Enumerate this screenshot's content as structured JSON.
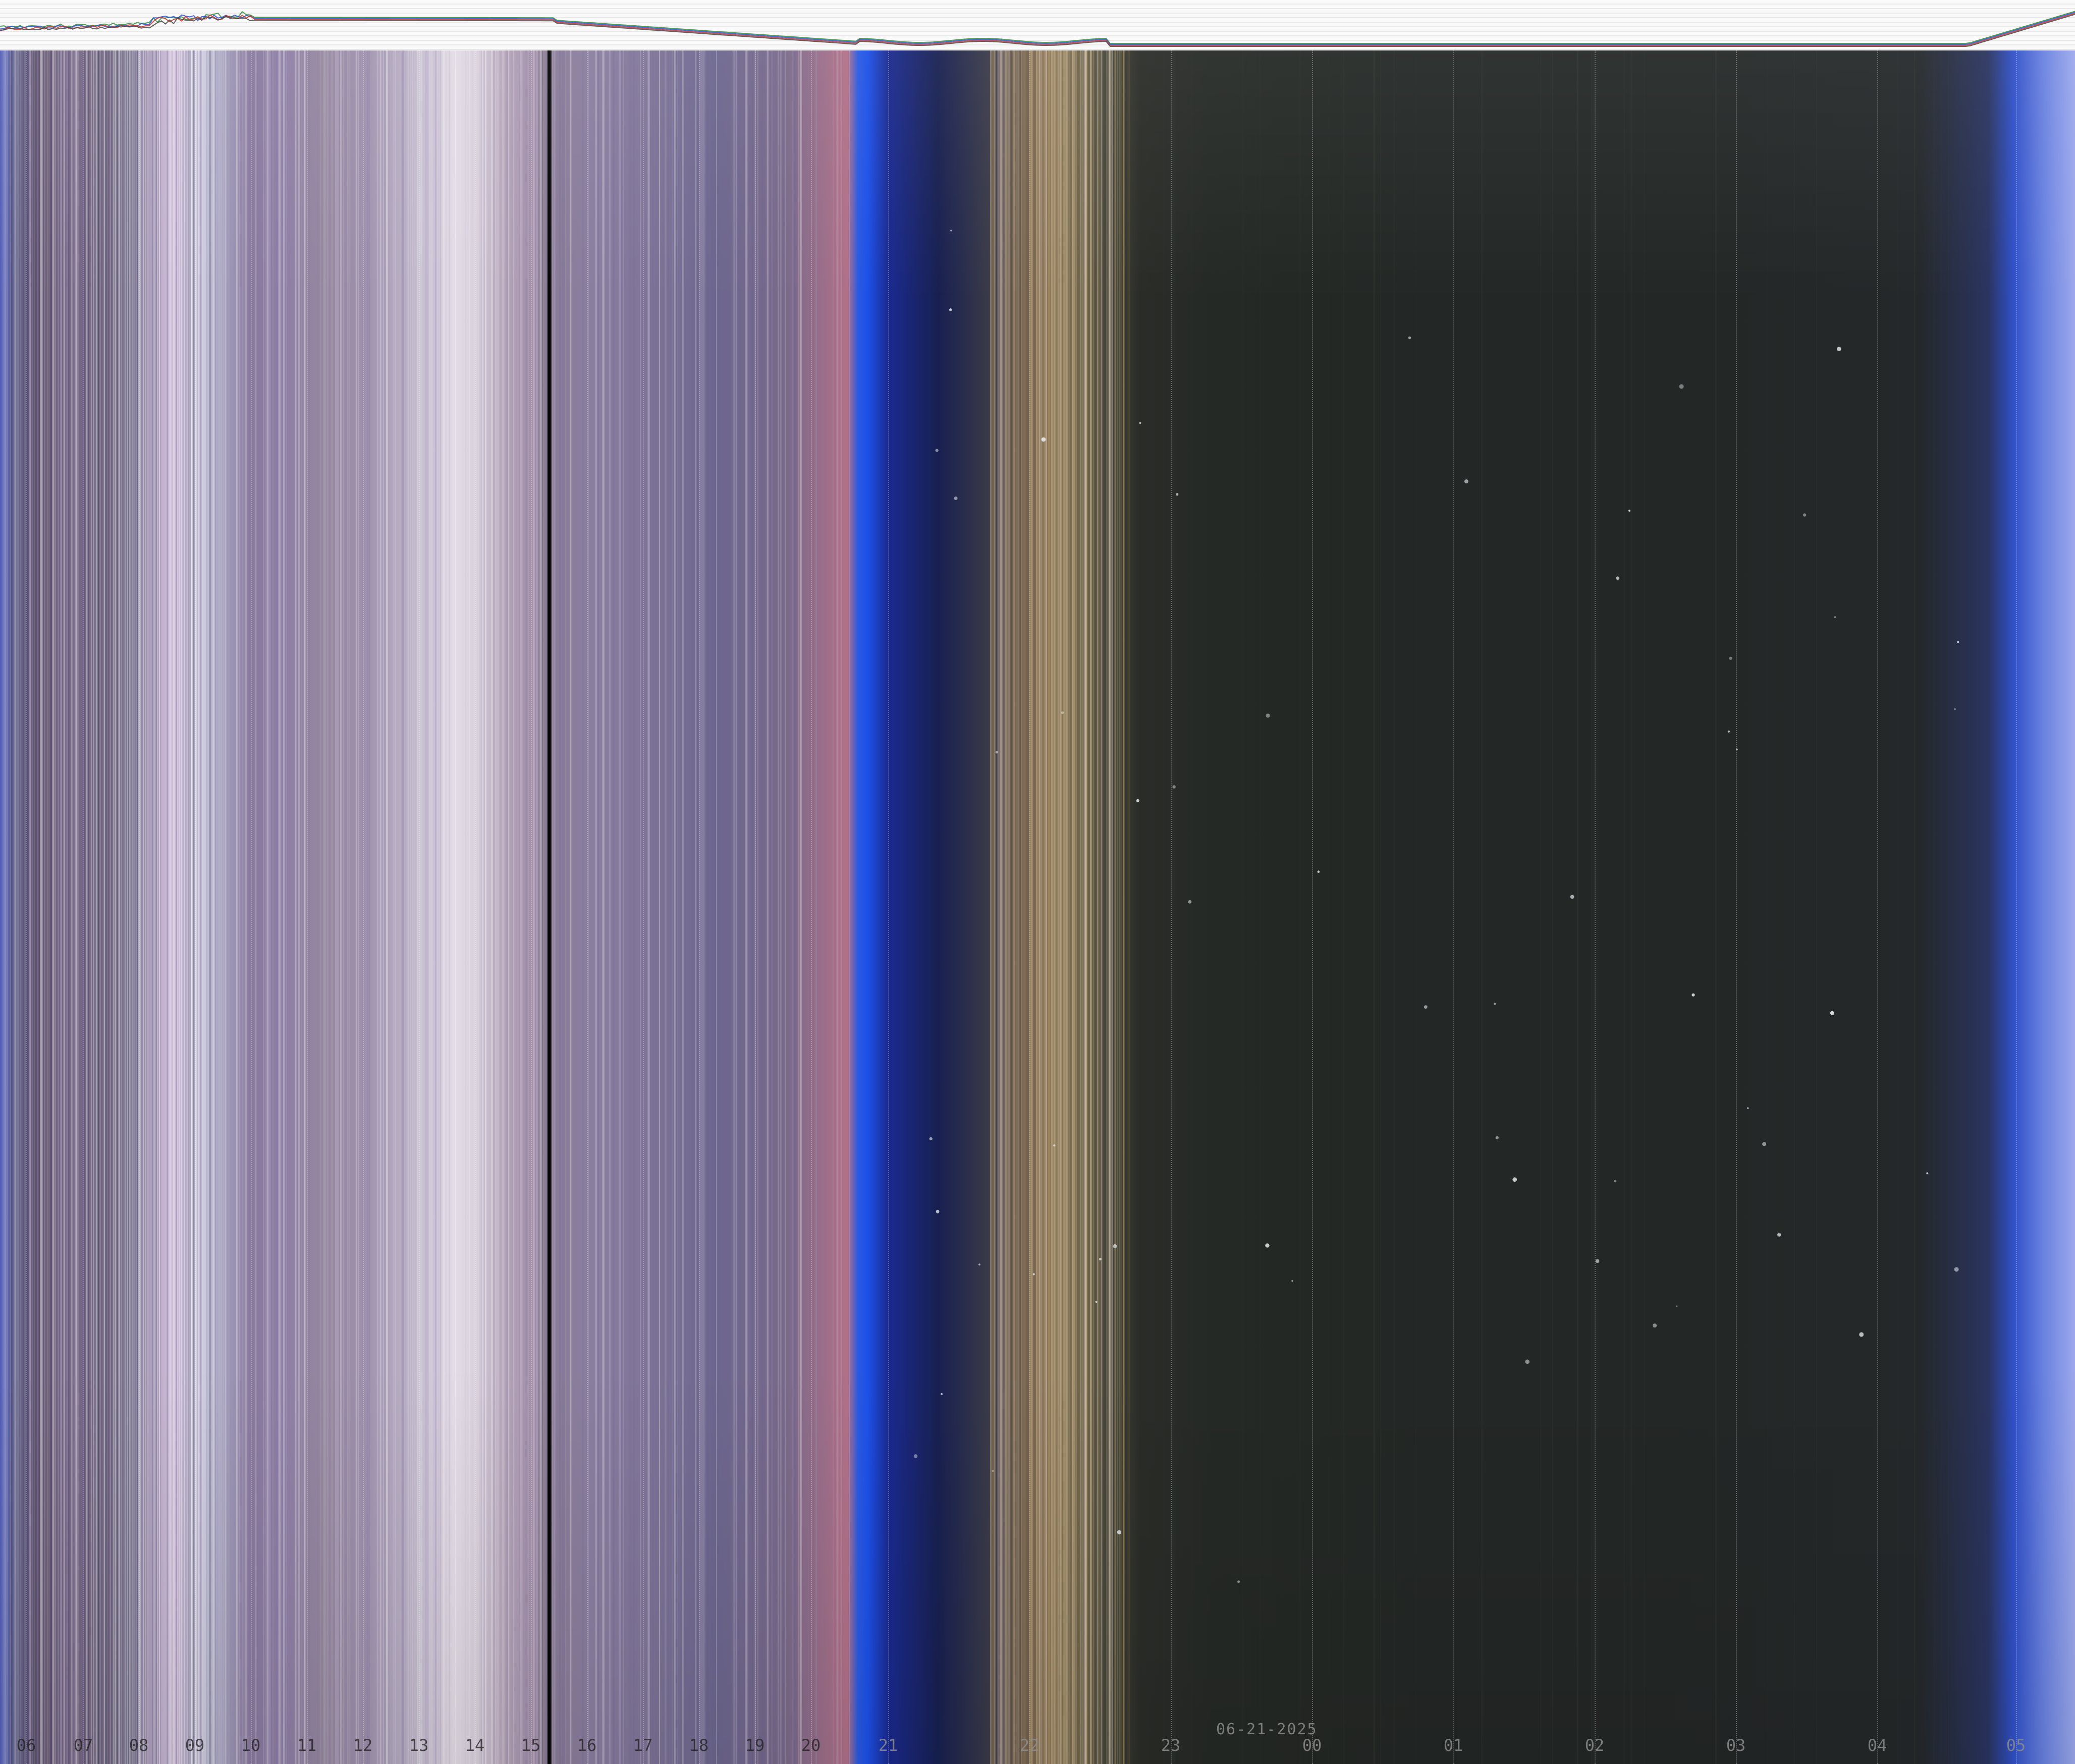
{
  "graph": {
    "series_colors": [
      "#2e8b3e",
      "#2a4fd0",
      "#c8342c",
      "#444444"
    ]
  },
  "keogram": {
    "date_label": "06-21-2025",
    "hour_labels": [
      "06",
      "07",
      "08",
      "09",
      "10",
      "11",
      "12",
      "13",
      "14",
      "15",
      "16",
      "17",
      "18",
      "19",
      "20",
      "21",
      "22",
      "23",
      "00",
      "01",
      "02",
      "03",
      "04",
      "05"
    ]
  }
}
